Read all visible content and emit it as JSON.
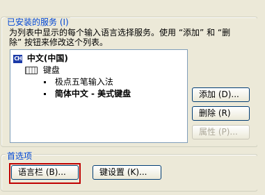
{
  "installed_services": {
    "legend": "已安装的服务 (I)",
    "description_line1": "为列表中显示的每个输入语言选择服务。使用 “添加” 和 “删",
    "description_line2": "除” 按钮来修改这个列表。",
    "tree": {
      "language_code": "CH",
      "language": "中文(中国)",
      "keyboard_category": "键盘",
      "items": [
        "极点五笔输入法",
        "简体中文 - 美式键盘"
      ]
    },
    "buttons": {
      "add": "添加 (D)...",
      "remove": "删除 (R)",
      "properties": "属性 (P)..."
    }
  },
  "preferences": {
    "legend": "首选项",
    "language_bar_button": "语言栏 (B)...",
    "key_settings_button": "键设置 (K)..."
  },
  "colors": {
    "legend_blue": "#0046d5",
    "highlight_red": "#c00000"
  }
}
